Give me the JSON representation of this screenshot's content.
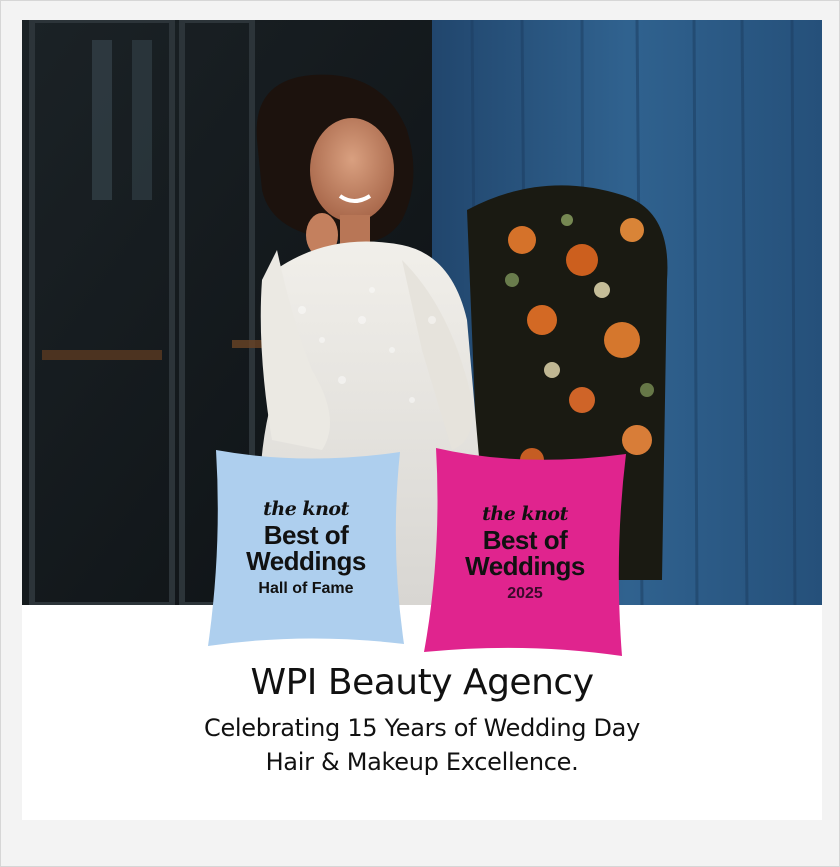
{
  "colors": {
    "badge_blue": "#aecfee",
    "badge_pink": "#e0248e",
    "curtain_blue": "#2d5680",
    "text": "#111111"
  },
  "badges": [
    {
      "brand": "the knot",
      "line1": "Best of",
      "line2": "Weddings",
      "sub": "Hall of Fame"
    },
    {
      "brand": "the knot",
      "line1": "Best of",
      "line2": "Weddings",
      "sub": "2025"
    }
  ],
  "headline": "WPI Beauty Agency",
  "tagline": {
    "line1": "Celebrating 15 Years of Wedding Day",
    "line2": "Hair & Makeup Excellence."
  }
}
